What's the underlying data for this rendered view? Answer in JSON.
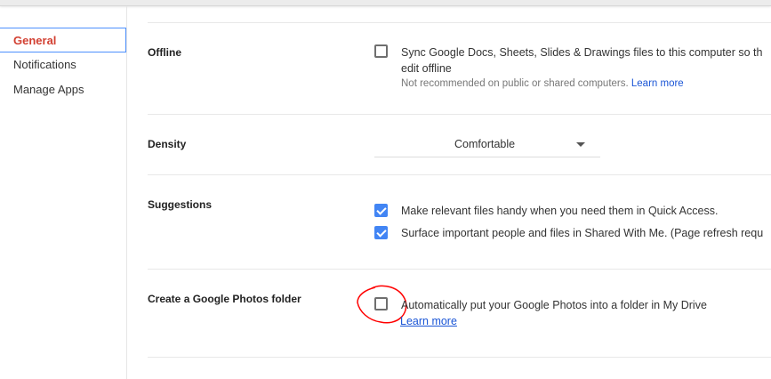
{
  "sidebar": {
    "items": [
      {
        "label": "General",
        "active": true
      },
      {
        "label": "Notifications"
      },
      {
        "label": "Manage Apps"
      }
    ]
  },
  "offline": {
    "label": "Offline",
    "text": "Sync Google Docs, Sheets, Slides & Drawings files to this computer so th",
    "text2": "edit offline",
    "sub": "Not recommended on public or shared computers.",
    "link": "Learn more",
    "checked": false
  },
  "density": {
    "label": "Density",
    "value": "Comfortable"
  },
  "suggestions": {
    "label": "Suggestions",
    "items": [
      {
        "text": "Make relevant files handy when you need them in Quick Access.",
        "checked": true
      },
      {
        "text": "Surface important people and files in Shared With Me. (Page refresh requ",
        "checked": true
      }
    ]
  },
  "photos": {
    "label": "Create a Google Photos folder",
    "text": "Automatically put your Google Photos into a folder in My Drive",
    "link": "Learn more",
    "checked": false
  },
  "colors": {
    "accent": "#4285f4",
    "active_nav": "#d23f31",
    "annotation": "#ff0000"
  }
}
